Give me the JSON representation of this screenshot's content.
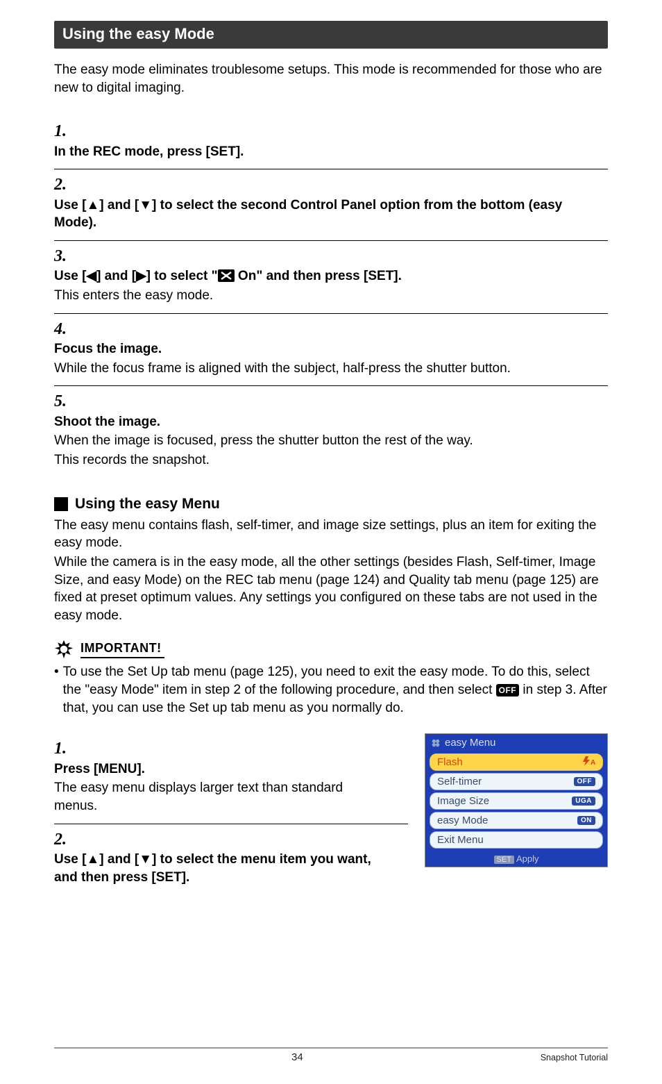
{
  "section_title": "Using the easy Mode",
  "intro": "The easy mode eliminates troublesome setups. This mode is recommended for those who are new to digital imaging.",
  "steps_a": [
    {
      "num": "1.",
      "title": "In the REC mode, press [SET].",
      "desc": ""
    },
    {
      "num": "2.",
      "title": "Use [▲] and [▼] to select the second Control Panel option from the bottom (easy Mode).",
      "desc": ""
    },
    {
      "num": "3.",
      "title_pre": "Use [◀] and [▶] to select \"",
      "title_post": " On\" and then press [SET].",
      "desc": "This enters the easy mode."
    },
    {
      "num": "4.",
      "title": "Focus the image.",
      "desc": "While the focus frame is aligned with the subject, half-press the shutter button."
    },
    {
      "num": "5.",
      "title": "Shoot the image.",
      "desc_lines": [
        "When the image is focused, press the shutter button the rest of the way.",
        "This records the snapshot."
      ]
    }
  ],
  "sub_heading": "Using the easy Menu",
  "easy_menu_para1": "The easy menu contains flash, self-timer, and image size settings, plus an item for exiting the easy mode.",
  "easy_menu_para2": "While the camera is in the easy mode, all the other settings (besides Flash, Self-timer, Image Size, and easy Mode) on the REC tab menu (page 124) and Quality tab menu (page 125) are fixed at preset optimum values. Any settings you configured on these tabs are not used in the easy mode.",
  "important_label": "IMPORTANT!",
  "important_bullet_pre": "To use the Set Up tab menu (page 125), you need to exit the easy mode. To do this, select the \"easy Mode\" item in step 2 of the following procedure, and then select ",
  "important_off_badge": "OFF",
  "important_bullet_post": " in step 3. After that, you can use the Set up tab menu as you normally do.",
  "steps_b": [
    {
      "num": "1.",
      "title": "Press [MENU].",
      "desc": "The easy menu displays larger text than standard menus."
    },
    {
      "num": "2.",
      "title": "Use [▲] and [▼] to select the menu item you want, and then press [SET].",
      "desc": ""
    }
  ],
  "menu": {
    "title": "easy Menu",
    "footer_chip": "SET",
    "footer_text": "Apply",
    "items": [
      {
        "label": "Flash",
        "value": "⚡A",
        "selected": true
      },
      {
        "label": "Self-timer",
        "value": "OFF",
        "selected": false
      },
      {
        "label": "Image Size",
        "value": "UGA",
        "selected": false
      },
      {
        "label": "easy Mode",
        "value": "ON",
        "selected": false
      },
      {
        "label": "Exit Menu",
        "value": "",
        "selected": false
      }
    ]
  },
  "footer": {
    "page": "34",
    "crumb": "Snapshot Tutorial"
  }
}
